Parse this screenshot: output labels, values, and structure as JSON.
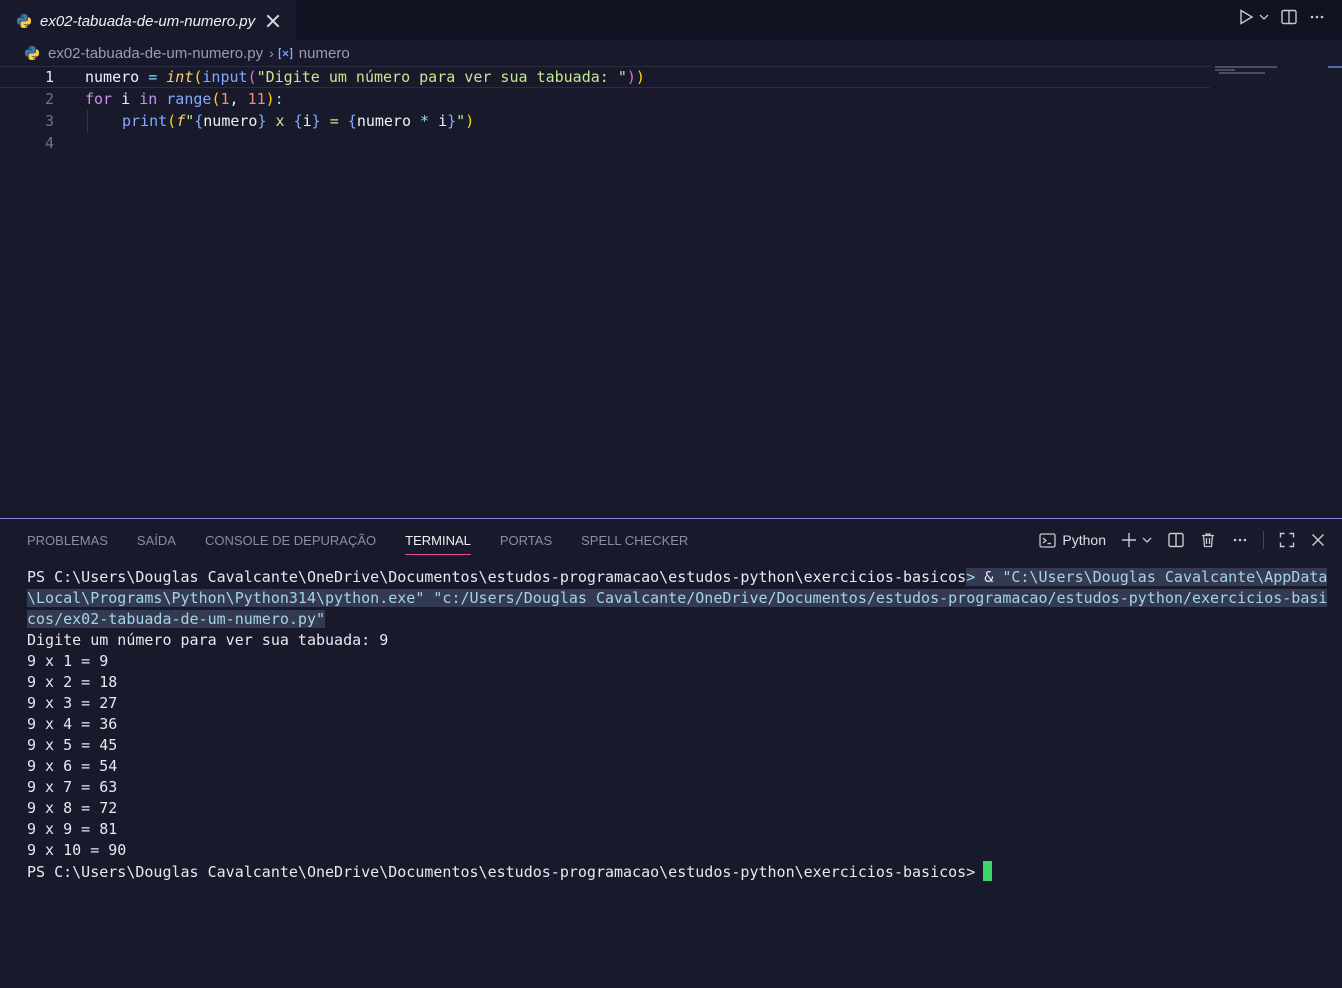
{
  "tab": {
    "filename": "ex02-tabuada-de-um-numero.py",
    "icon": "python-icon"
  },
  "breadcrumb": {
    "file": "ex02-tabuada-de-um-numero.py",
    "symbol": "numero"
  },
  "editor": {
    "line_numbers": [
      "1",
      "2",
      "3",
      "4"
    ],
    "line1": {
      "var": "numero",
      "eq": " = ",
      "int": "int",
      "p1": "(",
      "input": "input",
      "p2": "(",
      "str": "\"Digite um número para ver sua tabuada: \"",
      "p3": ")",
      "p4": ")"
    },
    "line2": {
      "for": "for",
      "i": " i ",
      "in": "in",
      "range": " range",
      "p1": "(",
      "n1": "1",
      "comma": ", ",
      "n2": "11",
      "p2": ")",
      "colon": ":"
    },
    "line3": {
      "print": "print",
      "p1": "(",
      "f": "f",
      "q1": "\"",
      "b1": "{",
      "v1": "numero",
      "b2": "}",
      "x": " x ",
      "b3": "{",
      "v2": "i",
      "b4": "}",
      "eq": " = ",
      "b5": "{",
      "v3": "numero",
      "star": " * ",
      "v4": "i",
      "b6": "}",
      "q2": "\"",
      "p2": ")"
    }
  },
  "panel": {
    "tabs": [
      "PROBLEMAS",
      "SAÍDA",
      "CONSOLE DE DEPURAÇÃO",
      "TERMINAL",
      "PORTAS",
      "SPELL CHECKER"
    ],
    "active_tab": "TERMINAL",
    "shell_label": "Python"
  },
  "terminal": {
    "prompt1_plain": "PS C:\\Users\\Douglas Cavalcante\\OneDrive\\Documentos\\estudos-programacao\\estudos-python\\exercicios-basicos",
    "prompt1_sel_a": "> ",
    "prompt1_amp": "&",
    "prompt1_sel_b": " \"C:\\Users\\Douglas Cavalcante\\AppData",
    "cmd_line2": "\\Local\\Programs\\Python\\Python314\\python.exe\" \"c:/Users/Douglas Cavalcante/OneDrive/Documentos/estudos-programacao/estudos-python/exercicios-basi",
    "cmd_line3": "cos/ex02-tabuada-de-um-numero.py\"",
    "output": [
      "Digite um número para ver sua tabuada: 9",
      "9 x 1 = 9",
      "9 x 2 = 18",
      "9 x 3 = 27",
      "9 x 4 = 36",
      "9 x 5 = 45",
      "9 x 6 = 54",
      "9 x 7 = 63",
      "9 x 8 = 72",
      "9 x 9 = 81",
      "9 x 10 = 90"
    ],
    "prompt_final": "PS C:\\Users\\Douglas Cavalcante\\OneDrive\\Documentos\\estudos-programacao\\estudos-python\\exercicios-basicos>"
  },
  "colors": {
    "accent_border": "#8b7fd9",
    "active_tab_underline": "#e04ea0",
    "cursor": "#3cd66a"
  }
}
